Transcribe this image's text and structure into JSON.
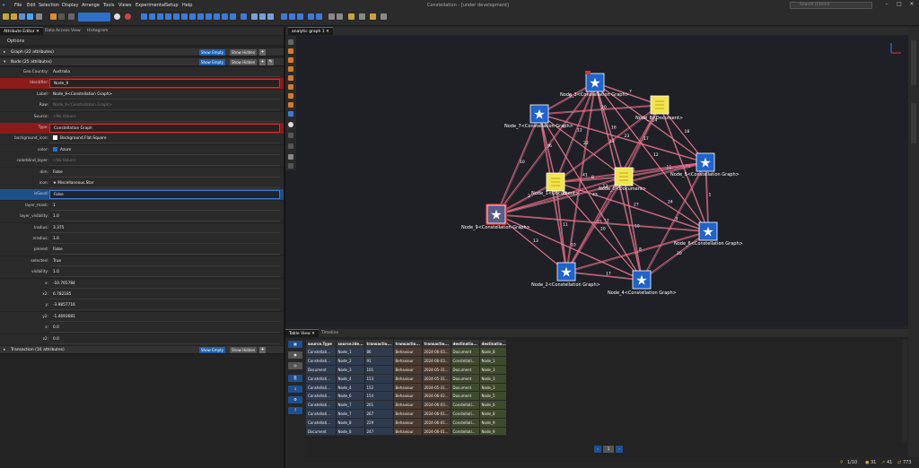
{
  "menubar": {
    "items": [
      "File",
      "Edit",
      "Selection",
      "Display",
      "Arrange",
      "Tools",
      "Views",
      "Experimental",
      "Setup",
      "Help"
    ],
    "title": "Constellation - [under development]",
    "search_placeholder": "Search (Ctrl+I)"
  },
  "left_tabs": [
    "Attribute Editor",
    "Data Access View",
    "Histogram"
  ],
  "options_label": "Options",
  "sections": {
    "graph": "Graph (22 attributes)",
    "node": "Node (25 attributes)",
    "transaction": "Transaction (16 attributes)",
    "show_empty": "Show Empty",
    "show_hidden": "Show Hidden",
    "plus": "+"
  },
  "attributes": [
    {
      "key": "Geo.Country:",
      "value": "Australia",
      "style": "shade"
    },
    {
      "key": "Identifier:",
      "value": "Node_9",
      "style": "red"
    },
    {
      "key": "Label:",
      "value": "Node_9<Constellation Graph>",
      "style": "shade"
    },
    {
      "key": "Raw:",
      "value": "Node_9<Constellation Graph>",
      "style": "shade",
      "muted": true
    },
    {
      "key": "Source:",
      "value": "<No Value>",
      "style": "shade",
      "muted": true
    },
    {
      "key": "Type:",
      "value": "Constellation Graph",
      "style": "red"
    },
    {
      "key": "background_icon:",
      "value": "Background.Flat.Square",
      "style": "shade",
      "swatch": "#ffffff"
    },
    {
      "key": "color:",
      "value": "Azure",
      "style": "shade",
      "swatch": "#1e73d8"
    },
    {
      "key": "colorblind_layer:",
      "value": "<No Value>",
      "style": "shade",
      "muted": true
    },
    {
      "key": "dim:",
      "value": "False",
      "style": "shade"
    },
    {
      "key": "icon:",
      "value": "Miscellaneous.Star",
      "style": "shade",
      "star": true
    },
    {
      "key": "isGood:",
      "value": "False",
      "style": "blue"
    },
    {
      "key": "layer_mask:",
      "value": "1",
      "style": "shade"
    },
    {
      "key": "layer_visibility:",
      "value": "1.0",
      "style": "shade"
    },
    {
      "key": "lradius:",
      "value": "3.375",
      "style": "shade"
    },
    {
      "key": "nradius:",
      "value": "1.0",
      "style": "shade"
    },
    {
      "key": "pinned:",
      "value": "False",
      "style": "shade"
    },
    {
      "key": "selected:",
      "value": "True",
      "style": "shade"
    },
    {
      "key": "visibility:",
      "value": "1.0",
      "style": "shade"
    },
    {
      "key": "x:",
      "value": "-10.765784",
      "style": "shade"
    },
    {
      "key": "x2:",
      "value": "6.782185",
      "style": "shade"
    },
    {
      "key": "y:",
      "value": "-3.9857716",
      "style": "shade"
    },
    {
      "key": "y2:",
      "value": "-1.4693681",
      "style": "shade"
    },
    {
      "key": "z:",
      "value": "0.0",
      "style": "shade"
    },
    {
      "key": "z2:",
      "value": "0.0",
      "style": "shade"
    }
  ],
  "graph_tab": "analytic graph 1",
  "nodes": [
    {
      "id": "n3",
      "label": "Node_3<Constellation Graph>",
      "icon": "star"
    },
    {
      "id": "n7",
      "label": "Node_7<Constellation Graph>",
      "icon": "star"
    },
    {
      "id": "n8",
      "label": "Node_8<Document>",
      "icon": "doc"
    },
    {
      "id": "n5",
      "label": "Node_5<Constellation Graph>",
      "icon": "star"
    },
    {
      "id": "n1",
      "label": "Node_1<Document>",
      "icon": "doc"
    },
    {
      "id": "n0",
      "label": "Node_0<Document>",
      "icon": "doc"
    },
    {
      "id": "n9",
      "label": "Node_9<Constellation Graph>",
      "icon": "star",
      "selected": true
    },
    {
      "id": "n6",
      "label": "Node_6<Constellation Graph>",
      "icon": "star"
    },
    {
      "id": "n2",
      "label": "Node_2<Constellation Graph>",
      "icon": "star"
    },
    {
      "id": "n4",
      "label": "Node_4<Constellation Graph>",
      "icon": "star"
    }
  ],
  "edge_labels": [
    "9",
    "7",
    "14",
    "12",
    "16",
    "41",
    "18",
    "7",
    "20",
    "6",
    "22",
    "10",
    "14",
    "23",
    "18",
    "17",
    "15",
    "16",
    "13",
    "12",
    "1",
    "3",
    "2",
    "13",
    "8",
    "2",
    "11",
    "20",
    "27",
    "12",
    "24",
    "15",
    "10",
    "13",
    "10",
    "12",
    "8",
    "20",
    "17",
    "43",
    "12",
    "21",
    "15",
    "5",
    "3",
    "18",
    "23",
    "6",
    "17"
  ],
  "bottom_tabs": [
    "Table View",
    "Timeline"
  ],
  "table": {
    "columns": [
      "source.Type",
      "source.Ide...",
      "transactio...",
      "transactio...",
      "transactio...",
      "destinatio...",
      "destinatio..."
    ],
    "rows": [
      [
        "Constellati...",
        "Node_1",
        "86",
        "Behaviour",
        "2024-06-03...",
        "Document",
        "Node_8"
      ],
      [
        "Constellati...",
        "Node_2",
        "91",
        "Behaviour",
        "2024-06-03...",
        "Constellati...",
        "Node_1"
      ],
      [
        "Document",
        "Node_3",
        "101",
        "Behaviour",
        "2024-05-31...",
        "Document",
        "Node_3"
      ],
      [
        "Constellati...",
        "Node_4",
        "153",
        "Behaviour",
        "2024-05-31...",
        "Document",
        "Node_3"
      ],
      [
        "Constellati...",
        "Node_4",
        "152",
        "Behaviour",
        "2024-05-31...",
        "Document",
        "Node_3"
      ],
      [
        "Constellati...",
        "Node_6",
        "154",
        "Behaviour",
        "2024-06-02...",
        "Document",
        "Node_5"
      ],
      [
        "Constellati...",
        "Node_7",
        "201",
        "Behaviour",
        "2024-06-03...",
        "Constellati...",
        "Node_6"
      ],
      [
        "Constellati...",
        "Node_7",
        "267",
        "Behaviour",
        "2024-06-01...",
        "Constellati...",
        "Node_8"
      ],
      [
        "Constellati...",
        "Node_8",
        "229",
        "Behaviour",
        "2024-06-01...",
        "Constellati...",
        "Node_9"
      ],
      [
        "Document",
        "Node_8",
        "247",
        "Behaviour",
        "2024-06-01...",
        "Constellati...",
        "Node_9"
      ]
    ]
  },
  "pager": {
    "page": "1"
  },
  "status": {
    "zoom": "1/10",
    "nodes": "31",
    "edges": "41",
    "extra": "773"
  }
}
